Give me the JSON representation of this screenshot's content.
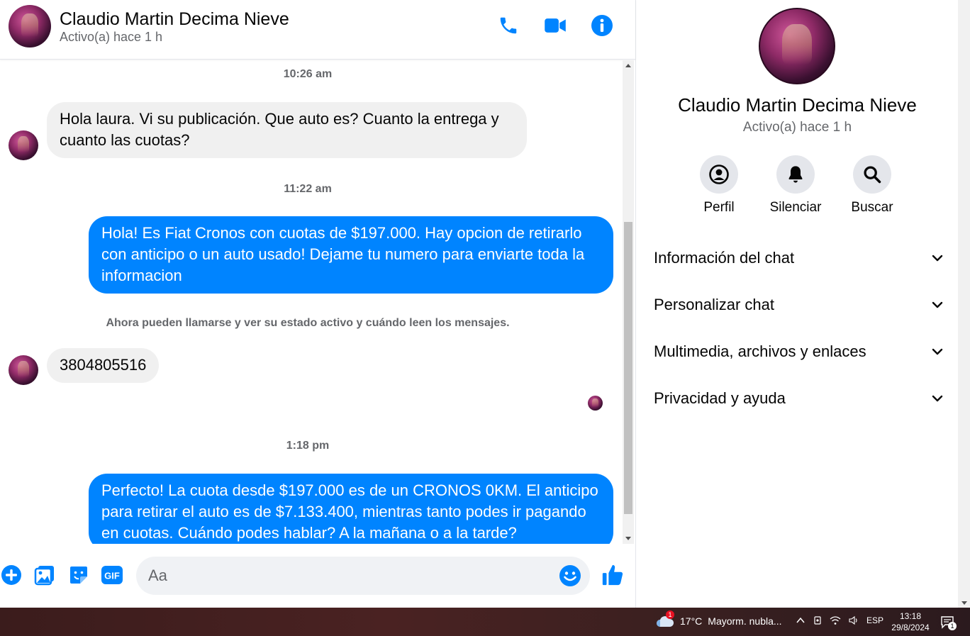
{
  "header": {
    "name": "Claudio Martin Decima Nieve",
    "status": "Activo(a) hace 1 h",
    "icons": [
      "phone-icon",
      "video-camera-icon",
      "info-icon"
    ]
  },
  "messages": [
    {
      "type": "timestamp",
      "text": "10:26 am"
    },
    {
      "type": "incoming",
      "text": "Hola laura. Vi su publicación. Que auto es? Cuanto la entrega y cuanto las cuotas?"
    },
    {
      "type": "timestamp",
      "text": "11:22 am"
    },
    {
      "type": "outgoing",
      "text": "Hola! Es Fiat Cronos con cuotas de $197.000. Hay opcion de retirarlo con anticipo o un auto usado! Dejame tu numero para enviarte toda la informacion"
    },
    {
      "type": "notice",
      "text": "Ahora pueden llamarse y ver su estado activo y cuándo leen los mensajes."
    },
    {
      "type": "incoming",
      "text": "3804805516"
    },
    {
      "type": "timestamp",
      "text": "1:18 pm"
    },
    {
      "type": "outgoing",
      "text": "Perfecto! La cuota desde $197.000 es de un CRONOS 0KM. El anticipo para retirar el auto es de $7.133.400, mientras tanto podes ir pagando en cuotas. Cuándo podes hablar? A la mañana o a la tarde?"
    }
  ],
  "composer": {
    "placeholder": "Aa",
    "icons": [
      "plus-icon",
      "image-icon",
      "sticker-icon",
      "gif-icon",
      "emoji-icon",
      "thumbs-up-icon"
    ],
    "gif_label": "GIF"
  },
  "info_panel": {
    "name": "Claudio Martin Decima Nieve",
    "status": "Activo(a) hace 1 h",
    "actions": [
      {
        "label": "Perfil",
        "icon": "profile-icon"
      },
      {
        "label": "Silenciar",
        "icon": "bell-icon"
      },
      {
        "label": "Buscar",
        "icon": "search-icon"
      }
    ],
    "sections": [
      {
        "title": "Información del chat"
      },
      {
        "title": "Personalizar chat"
      },
      {
        "title": "Multimedia, archivos y enlaces"
      },
      {
        "title": "Privacidad y ayuda"
      }
    ]
  },
  "taskbar": {
    "weather_badge": "1",
    "temperature": "17°C",
    "weather_text": "Mayorm. nubla...",
    "language": "ESP",
    "time": "13:18",
    "date": "29/8/2024",
    "notification_count": "1"
  },
  "colors": {
    "accent": "#0084ff",
    "incoming_bubble": "#f0f0f0",
    "secondary_text": "#65676b"
  }
}
